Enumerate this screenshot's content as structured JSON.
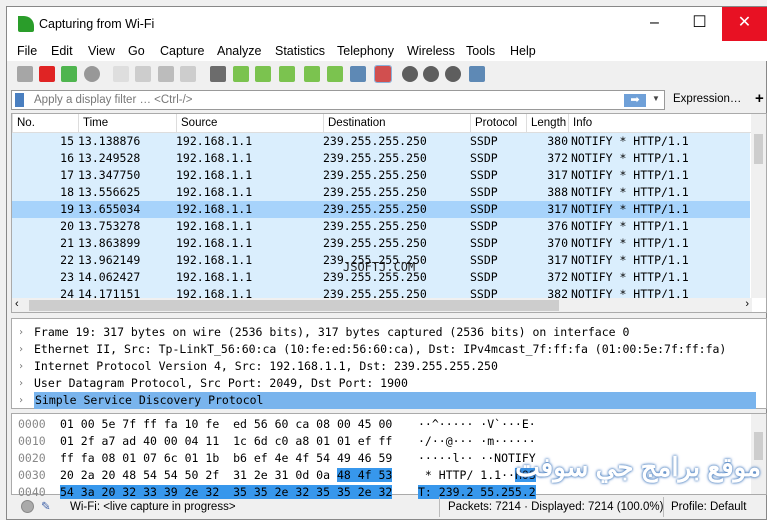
{
  "window": {
    "title": "Capturing from Wi-Fi",
    "minimize": "–",
    "maximize": "☐",
    "close": "✕"
  },
  "menu": [
    "File",
    "Edit",
    "View",
    "Go",
    "Capture",
    "Analyze",
    "Statistics",
    "Telephony",
    "Wireless",
    "Tools",
    "Help"
  ],
  "toolbar": [
    "start-capture",
    "stop-capture",
    "restart-capture",
    "capture-options",
    "open-file",
    "save-file",
    "close-file",
    "reload-file",
    "find-packet",
    "go-back",
    "go-forward",
    "go-to-packet",
    "go-first",
    "go-last",
    "autoscroll",
    "colorize",
    "zoom-in",
    "zoom-out",
    "zoom-normal",
    "resize-columns"
  ],
  "filter": {
    "placeholder": "Apply a display filter … <Ctrl-/>",
    "apply": "➡",
    "expression": "Expression…",
    "add": "+"
  },
  "packet_list": {
    "columns": [
      "No.",
      "Time",
      "Source",
      "Destination",
      "Protocol",
      "Length",
      "Info"
    ],
    "selected_no": "19",
    "rows": [
      [
        "15",
        "13.138876",
        "192.168.1.1",
        "239.255.255.250",
        "SSDP",
        "380",
        "NOTIFY * HTTP/1.1"
      ],
      [
        "16",
        "13.249528",
        "192.168.1.1",
        "239.255.255.250",
        "SSDP",
        "372",
        "NOTIFY * HTTP/1.1"
      ],
      [
        "17",
        "13.347750",
        "192.168.1.1",
        "239.255.255.250",
        "SSDP",
        "317",
        "NOTIFY * HTTP/1.1"
      ],
      [
        "18",
        "13.556625",
        "192.168.1.1",
        "239.255.255.250",
        "SSDP",
        "388",
        "NOTIFY * HTTP/1.1"
      ],
      [
        "19",
        "13.655034",
        "192.168.1.1",
        "239.255.255.250",
        "SSDP",
        "317",
        "NOTIFY * HTTP/1.1"
      ],
      [
        "20",
        "13.753278",
        "192.168.1.1",
        "239.255.255.250",
        "SSDP",
        "376",
        "NOTIFY * HTTP/1.1"
      ],
      [
        "21",
        "13.863899",
        "192.168.1.1",
        "239.255.255.250",
        "SSDP",
        "370",
        "NOTIFY * HTTP/1.1"
      ],
      [
        "22",
        "13.962149",
        "192.168.1.1",
        "239.255.255.250",
        "SSDP",
        "317",
        "NOTIFY * HTTP/1.1"
      ],
      [
        "23",
        "14.062427",
        "192.168.1.1",
        "239.255.255.250",
        "SSDP",
        "372",
        "NOTIFY * HTTP/1.1"
      ],
      [
        "24",
        "14.171151",
        "192.168.1.1",
        "239.255.255.250",
        "SSDP",
        "382",
        "NOTIFY * HTTP/1.1"
      ]
    ]
  },
  "details": [
    "Frame 19: 317 bytes on wire (2536 bits), 317 bytes captured (2536 bits) on interface 0",
    "Ethernet II, Src: Tp-LinkT_56:60:ca (10:fe:ed:56:60:ca), Dst: IPv4mcast_7f:ff:fa (01:00:5e:7f:ff:fa)",
    "Internet Protocol Version 4, Src: 192.168.1.1, Dst: 239.255.255.250",
    "User Datagram Protocol, Src Port: 2049, Dst Port: 1900",
    "Simple Service Discovery Protocol"
  ],
  "details_selected": 4,
  "hex": [
    {
      "off": "0000",
      "bytes": "01 00 5e 7f ff fa 10 fe  ed 56 60 ca 08 00 45 00",
      "ascii": "··^····· ·V`···E·"
    },
    {
      "off": "0010",
      "bytes": "01 2f a7 ad 40 00 04 11  1c 6d c0 a8 01 01 ef ff",
      "ascii": "·/··@··· ·m······"
    },
    {
      "off": "0020",
      "bytes": "ff fa 08 01 07 6c 01 1b  b6 ef 4e 4f 54 49 46 59",
      "ascii": "·····l·· ··NOTIFY"
    },
    {
      "off": "0030",
      "bytes": "20 2a 20 48 54 54 50 2f  31 2e 31 0d 0a ",
      "bytes_hl": "48 4f 53",
      "ascii": " * HTTP/ 1.1··",
      "ascii_hl": "HOS"
    },
    {
      "off": "0040",
      "bytes": "",
      "bytes_hl": "54 3a 20 32 33 39 2e 32  35 35 2e 32 35 35 2e 32",
      "ascii": "",
      "ascii_hl": "T: 239.2 55.255.2"
    }
  ],
  "status": {
    "interface": "Wi-Fi: <live capture in progress>",
    "packets": "Packets: 7214 · Displayed: 7214 (100.0%)",
    "profile": "Profile: Default"
  },
  "watermarks": [
    "JSOFTJ.COM",
    "موقع برامج جي سوفت"
  ],
  "colors": {
    "row_bg": "#daeefd",
    "row_selected": "#a7d3fb",
    "detail_selected": "#79b4ed",
    "hex_highlight": "#3797ec",
    "close": "#e81123"
  }
}
